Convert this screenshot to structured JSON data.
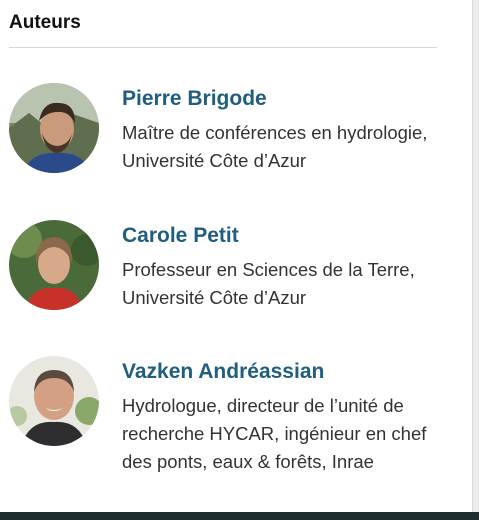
{
  "section": {
    "title": "Auteurs"
  },
  "authors": [
    {
      "name": "Pierre Brigode",
      "description": "Maître de conférences en hydrologie, Université Côte d’Azur"
    },
    {
      "name": "Carole Petit",
      "description": "Professeur en Sciences de la Terre, Université Côte d’Azur"
    },
    {
      "name": "Vazken Andréassian",
      "description": "Hydrologue, directeur de l’unité de recherche HYCAR, ingénieur en chef des ponts, eaux & forêts, Inrae"
    }
  ],
  "colors": {
    "name_link": "#1f5e7e",
    "text": "#333333",
    "footer": "#1f2d2f"
  }
}
